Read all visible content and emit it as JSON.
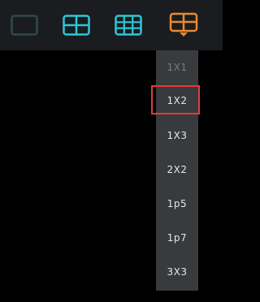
{
  "toolbar": {
    "buttons": [
      {
        "icon": "single-view-icon",
        "color": "#2f4a4f"
      },
      {
        "icon": "grid-2x2-icon",
        "color": "#2fc6d6"
      },
      {
        "icon": "grid-3x3-icon",
        "color": "#2fc6d6"
      },
      {
        "icon": "layout-menu-icon",
        "color": "#e88a2e"
      }
    ]
  },
  "layout_menu": {
    "items": [
      {
        "label": "1X1",
        "state": "disabled"
      },
      {
        "label": "1X2",
        "state": "selected"
      },
      {
        "label": "1X3",
        "state": "normal"
      },
      {
        "label": "2X2",
        "state": "normal"
      },
      {
        "label": "1p5",
        "state": "normal"
      },
      {
        "label": "1p7",
        "state": "normal"
      },
      {
        "label": "3X3",
        "state": "normal"
      }
    ],
    "selected_outline_color": "#e63a3a"
  }
}
